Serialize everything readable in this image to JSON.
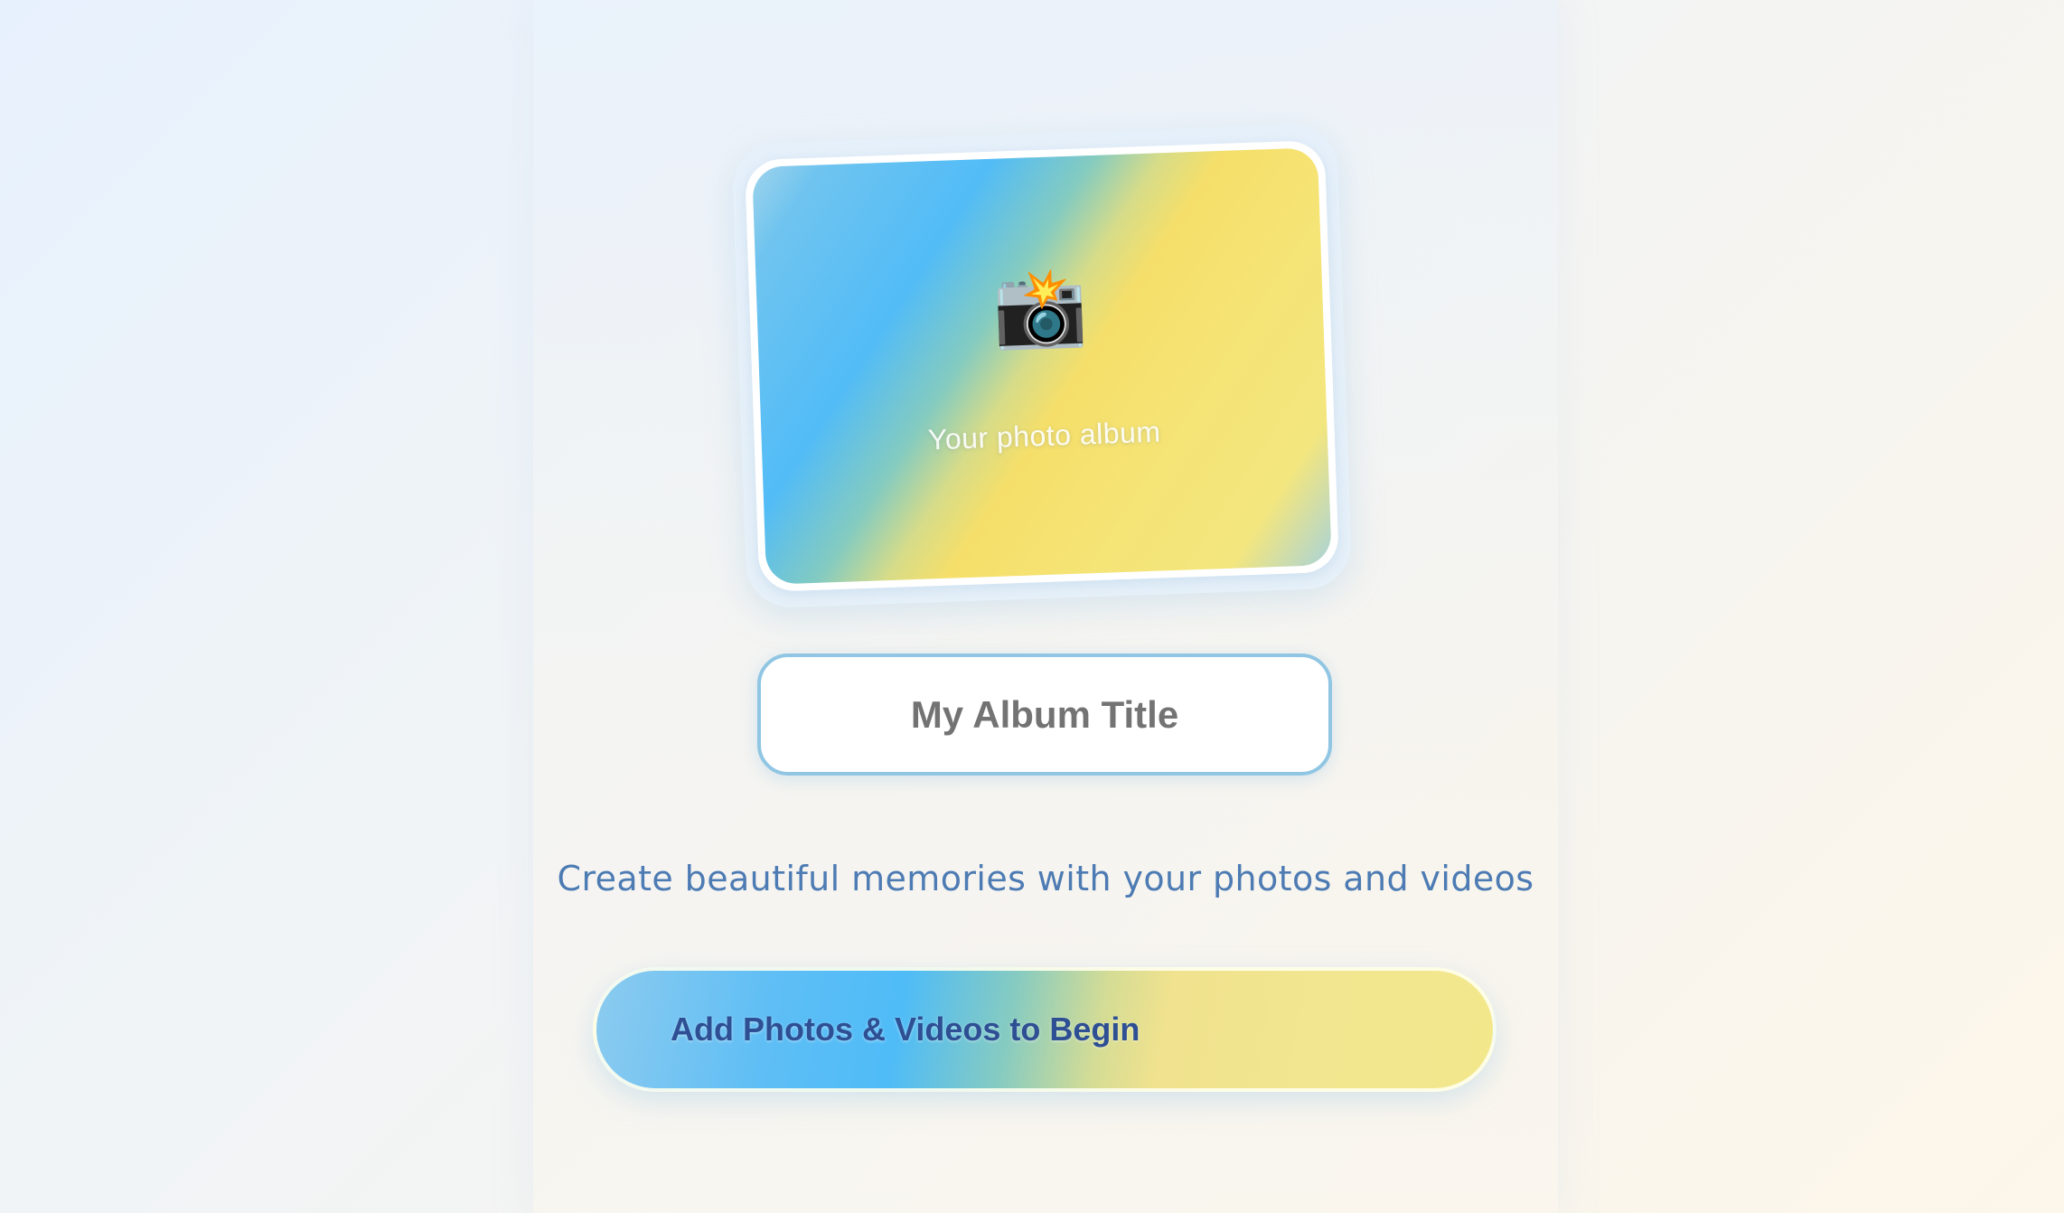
{
  "album_card": {
    "icon": "camera-with-flash-icon",
    "icon_glyph": "📸",
    "caption": "Your photo album"
  },
  "title_field": {
    "placeholder": "My Album Title",
    "value": ""
  },
  "tagline": "Create beautiful memories with your photos and videos",
  "cta_button": {
    "label": "Add Photos & Videos to Begin"
  },
  "colors": {
    "accent_blue": "#52bcf7",
    "accent_yellow": "#f5df6a",
    "tagline": "#4d7bb3",
    "button_text": "#2e4f93",
    "input_border": "#90c6e3"
  }
}
